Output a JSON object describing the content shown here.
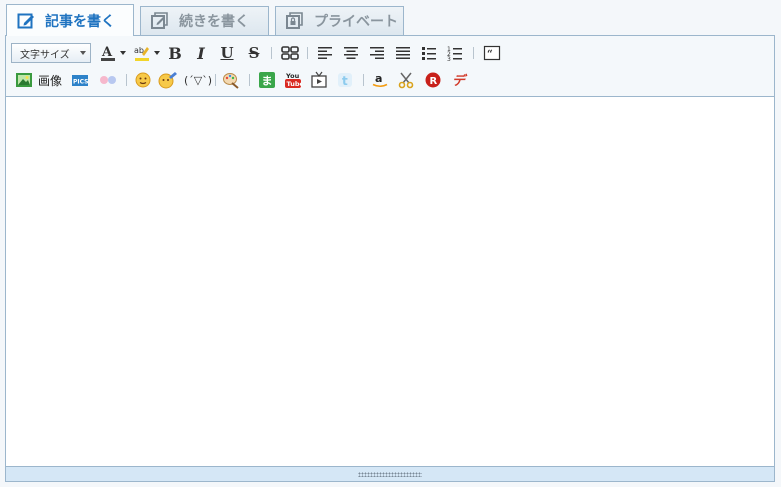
{
  "tabs": [
    {
      "label": "記事を書く",
      "icon": "edit-icon",
      "active": true
    },
    {
      "label": "続きを書く",
      "icon": "edit-continue-icon",
      "active": false
    },
    {
      "label": "プライベート",
      "icon": "private-icon",
      "active": false
    }
  ],
  "toolbar": {
    "font_size_select": "文字サイズ",
    "image_label": "画像",
    "kaomoji_label": "(´▽`)",
    "bold": "B",
    "italic": "I",
    "underline": "U",
    "strike": "S"
  },
  "colors": {
    "accent": "#1f73c0",
    "border": "#9cb6cc",
    "toolbar_bg": "#f4f8fb",
    "resize_bg": "#d5e7f6"
  }
}
